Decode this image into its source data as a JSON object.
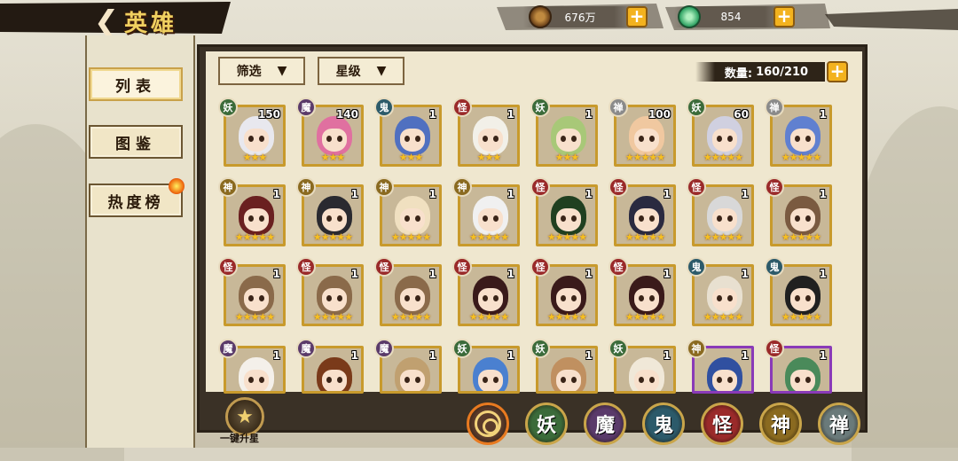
{
  "header": {
    "back_icon": "back-arrow-icon",
    "title": "英雄"
  },
  "resources": [
    {
      "name": "coin",
      "icon": "coin-stack-icon",
      "value": "676万"
    },
    {
      "name": "jade",
      "icon": "jade-icon",
      "value": "854"
    }
  ],
  "nav": [
    {
      "label": "列表",
      "active": true
    },
    {
      "label": "图鉴",
      "active": false
    },
    {
      "label": "热度榜",
      "active": false
    }
  ],
  "filters": {
    "filter_label": "筛选",
    "star_label": "星级"
  },
  "count": {
    "label": "数量:",
    "value": "160/210"
  },
  "heroes": [
    {
      "faction": "妖",
      "level": "150",
      "stars": "★★★",
      "hair": "#e8e8ee"
    },
    {
      "faction": "魔",
      "level": "140",
      "stars": "★★★",
      "hair": "#e070a0"
    },
    {
      "faction": "鬼",
      "level": "1",
      "stars": "★★★",
      "hair": "#5070c0"
    },
    {
      "faction": "怪",
      "level": "1",
      "stars": "★★★",
      "hair": "#f2f0e8"
    },
    {
      "faction": "妖",
      "level": "1",
      "stars": "★★★",
      "hair": "#a8c878"
    },
    {
      "faction": "禅",
      "level": "100",
      "stars": "★★★★★",
      "hair": "#f0c8a0"
    },
    {
      "faction": "妖",
      "level": "60",
      "stars": "★★★★★",
      "hair": "#d0d0e0"
    },
    {
      "faction": "禅",
      "level": "1",
      "stars": "★★★★★",
      "hair": "#6080d0"
    },
    {
      "faction": "神",
      "level": "1",
      "stars": "★★★★★",
      "hair": "#6a2020"
    },
    {
      "faction": "神",
      "level": "1",
      "stars": "★★★★★",
      "hair": "#2a2a30"
    },
    {
      "faction": "神",
      "level": "1",
      "stars": "★★★★★",
      "hair": "#f0e0c0"
    },
    {
      "faction": "神",
      "level": "1",
      "stars": "★★★★★",
      "hair": "#f0f0f0"
    },
    {
      "faction": "怪",
      "level": "1",
      "stars": "★★★★★",
      "hair": "#204020"
    },
    {
      "faction": "怪",
      "level": "1",
      "stars": "★★★★★",
      "hair": "#2a2a40"
    },
    {
      "faction": "怪",
      "level": "1",
      "stars": "★★★★★",
      "hair": "#d8d8d8"
    },
    {
      "faction": "怪",
      "level": "1",
      "stars": "★★★★★",
      "hair": "#7a5a40"
    },
    {
      "faction": "怪",
      "level": "1",
      "stars": "★★★★★",
      "hair": "#8a6a4a"
    },
    {
      "faction": "怪",
      "level": "1",
      "stars": "★★★★★",
      "hair": "#8a6a4a"
    },
    {
      "faction": "怪",
      "level": "1",
      "stars": "★★★★★",
      "hair": "#8a6a4a"
    },
    {
      "faction": "怪",
      "level": "1",
      "stars": "★★★★★",
      "hair": "#3a1a1a"
    },
    {
      "faction": "怪",
      "level": "1",
      "stars": "★★★★★",
      "hair": "#3a1a1a"
    },
    {
      "faction": "怪",
      "level": "1",
      "stars": "★★★★★",
      "hair": "#3a1a1a"
    },
    {
      "faction": "鬼",
      "level": "1",
      "stars": "★★★★★",
      "hair": "#e8e0d0"
    },
    {
      "faction": "鬼",
      "level": "1",
      "stars": "★★★★★",
      "hair": "#202020"
    },
    {
      "faction": "魔",
      "level": "1",
      "stars": "",
      "hair": "#f4f0ea"
    },
    {
      "faction": "魔",
      "level": "1",
      "stars": "",
      "hair": "#7a3a1a"
    },
    {
      "faction": "魔",
      "level": "1",
      "stars": "",
      "hair": "#c0a070"
    },
    {
      "faction": "妖",
      "level": "1",
      "stars": "",
      "hair": "#4a80d0"
    },
    {
      "faction": "妖",
      "level": "1",
      "stars": "",
      "hair": "#c09060"
    },
    {
      "faction": "妖",
      "level": "1",
      "stars": "",
      "hair": "#f0e8d8"
    },
    {
      "faction": "神",
      "level": "1",
      "stars": "",
      "hair": "#3050a0",
      "frame": "purple"
    },
    {
      "faction": "怪",
      "level": "1",
      "stars": "",
      "hair": "#4a8a5a",
      "frame": "purple"
    }
  ],
  "bottom": {
    "one_key_label": "一键升星",
    "faction_filters": [
      {
        "label": "",
        "icon": "all-factions-icon",
        "color": "#5a3a2a"
      },
      {
        "label": "妖",
        "color": "#3b6b3a"
      },
      {
        "label": "魔",
        "color": "#5a3a6a"
      },
      {
        "label": "鬼",
        "color": "#2c5a6a"
      },
      {
        "label": "怪",
        "color": "#9a2a2a"
      },
      {
        "label": "神",
        "color": "#8a6a20"
      },
      {
        "label": "禅",
        "color": "#6a7a7a"
      }
    ]
  }
}
